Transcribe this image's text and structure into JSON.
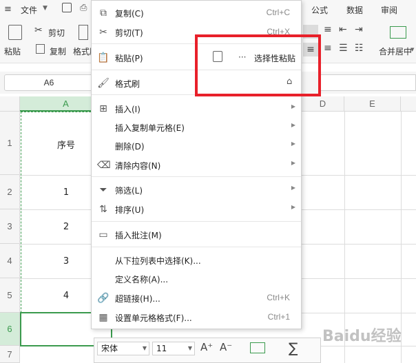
{
  "menubar": {
    "file_label": "文件",
    "tabs": [
      "公式",
      "数据",
      "审阅"
    ]
  },
  "ribbon": {
    "paste_label": "粘贴",
    "cut_label": "剪切",
    "copy_label": "复制",
    "format_painter_label": "格式刷",
    "merge_center_label": "合并居中"
  },
  "namebox": {
    "value": "A6"
  },
  "columns": [
    "A",
    "D",
    "E"
  ],
  "rows": [
    "1",
    "2",
    "3",
    "4",
    "5",
    "6",
    "7"
  ],
  "cells": {
    "a1": "序号",
    "a2": "1",
    "a3": "2",
    "a4": "3",
    "a5": "4"
  },
  "context_menu": {
    "copy": {
      "label": "复制(C)",
      "shortcut": "Ctrl+C"
    },
    "cut": {
      "label": "剪切(T)",
      "shortcut": "Ctrl+X"
    },
    "paste": {
      "label": "粘贴(P)",
      "more": "···",
      "paste_special": "选择性粘贴"
    },
    "format_painter": {
      "label": "格式刷"
    },
    "insert": {
      "label": "插入(I)"
    },
    "insert_copied": {
      "label": "插入复制单元格(E)"
    },
    "delete": {
      "label": "删除(D)"
    },
    "clear": {
      "label": "清除内容(N)"
    },
    "filter": {
      "label": "筛选(L)"
    },
    "sort": {
      "label": "排序(U)"
    },
    "comment": {
      "label": "插入批注(M)"
    },
    "pick_list": {
      "label": "从下拉列表中选择(K)..."
    },
    "define_name": {
      "label": "定义名称(A)..."
    },
    "hyperlink": {
      "label": "超链接(H)...",
      "shortcut": "Ctrl+K"
    },
    "format_cells": {
      "label": "设置单元格格式(F)...",
      "shortcut": "Ctrl+1"
    }
  },
  "mini_toolbar": {
    "font_name": "宋体",
    "font_size": "11"
  },
  "watermark": {
    "text": "Baidu经验"
  },
  "colors": {
    "selection": "#3a9a4d",
    "highlight_box": "#e8202a"
  }
}
